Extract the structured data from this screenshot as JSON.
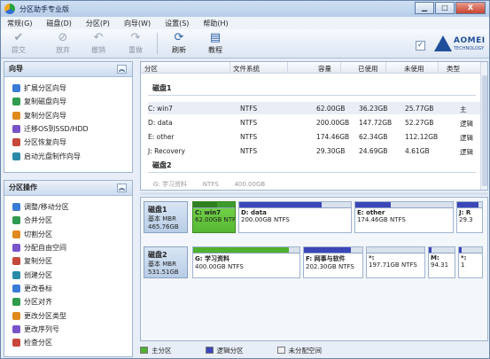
{
  "window": {
    "title": "分区助手专业版",
    "min": "▁",
    "max": "□",
    "close": "X"
  },
  "menu": [
    "常规(G)",
    "磁盘(D)",
    "分区(P)",
    "向导(W)",
    "设置(S)",
    "帮助(H)"
  ],
  "toolbar": {
    "commit": "提交",
    "discard": "放弃",
    "undo": "撤销",
    "redo": "重做",
    "refresh": "刷新",
    "tutorial": "教程",
    "logo_name": "AOMEI",
    "logo_sub": "TECHNOLOGY"
  },
  "wizard_panel": {
    "title": "向导",
    "items": [
      "扩展分区向导",
      "复制磁盘向导",
      "复制分区向导",
      "迁移OS到SSD/HDD",
      "分区恢复向导",
      "启动光盘制作向导"
    ]
  },
  "ops_panel": {
    "title": "分区操作",
    "items": [
      "调整/移动分区",
      "合并分区",
      "切割分区",
      "分配自由空间",
      "复制分区",
      "创建分区",
      "更改卷标",
      "分区对齐",
      "更改分区类型",
      "更改序列号",
      "检查分区"
    ]
  },
  "table": {
    "headers": [
      "分区",
      "文件系统",
      "容量",
      "已使用",
      "未使用",
      "类型"
    ],
    "disk1_label": "磁盘1",
    "disk2_label": "磁盘2",
    "rows": [
      {
        "name": "C: win7",
        "fs": "NTFS",
        "size": "62.00GB",
        "used": "36.23GB",
        "free": "25.77GB",
        "type": "主"
      },
      {
        "name": "D: data",
        "fs": "NTFS",
        "size": "200.00GB",
        "used": "147.72GB",
        "free": "52.27GB",
        "type": "逻辑"
      },
      {
        "name": "E: other",
        "fs": "NTFS",
        "size": "174.46GB",
        "used": "62.34GB",
        "free": "112.12GB",
        "type": "逻辑"
      },
      {
        "name": "J: Recovery",
        "fs": "NTFS",
        "size": "29.30GB",
        "used": "24.69GB",
        "free": "4.61GB",
        "type": "逻辑"
      }
    ],
    "partial_row": "G: 学习资料        NTFS        400.00GB"
  },
  "disk_map": {
    "disk1": {
      "label": "磁盘1",
      "kind": "基本 MBR",
      "size": "465.76GB"
    },
    "disk2": {
      "label": "磁盘2",
      "kind": "基本 MBR",
      "size": "531.51GB"
    },
    "d1_parts": [
      {
        "title": "C: win7",
        "sub": "62.00GB NTFS",
        "used": 0.58
      },
      {
        "title": "D: data",
        "sub": "200.00GB NTFS",
        "used": 0.74
      },
      {
        "title": "E: other",
        "sub": "174.46GB NTFS",
        "used": 0.36
      },
      {
        "title": "J: R",
        "sub": "29.3",
        "used": 0.84
      }
    ],
    "d2_parts": [
      {
        "title": "G: 学习资料",
        "sub": "400.00GB NTFS",
        "used": 0.9
      },
      {
        "title": "F: 网事与软件",
        "sub": "202.30GB NTFS",
        "used": 0.8
      },
      {
        "title": "*:",
        "sub": "197.71GB NTFS",
        "used": 0.0
      },
      {
        "title": "M:",
        "sub": "94.31",
        "used": 0.1
      },
      {
        "title": "*:",
        "sub": "1",
        "used": 0.1
      }
    ]
  },
  "legend": {
    "primary": "主分区",
    "logical": "逻辑分区",
    "unallocated": "未分配空间"
  },
  "colors": {
    "primary": "#4fb12f",
    "logical": "#3b46b8",
    "unallocated": "#f0f0f0"
  }
}
